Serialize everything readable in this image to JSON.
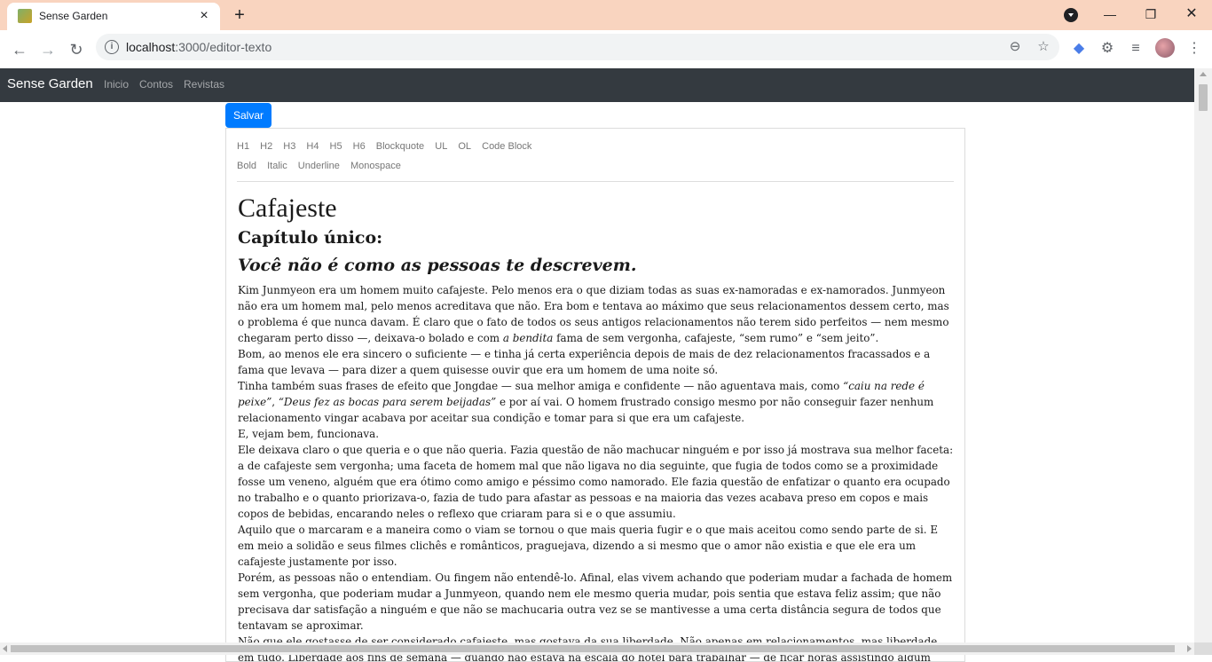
{
  "browser": {
    "tab_title": "Sense Garden",
    "url_host": "localhost",
    "url_path": ":3000/editor-texto",
    "info_icon": "info-icon",
    "tab_close": "×",
    "new_tab": "+"
  },
  "navbar": {
    "brand": "Sense Garden",
    "links": [
      "Inicio",
      "Contos",
      "Revistas"
    ]
  },
  "editor": {
    "save_label": "Salvar",
    "block_buttons": [
      "H1",
      "H2",
      "H3",
      "H4",
      "H5",
      "H6",
      "Blockquote",
      "UL",
      "OL",
      "Code Block"
    ],
    "inline_buttons": [
      "Bold",
      "Italic",
      "Underline",
      "Monospace"
    ]
  },
  "document": {
    "title": "Cafajeste",
    "subtitle": "Capítulo único:",
    "tagline": "Você não é como as pessoas te descrevem.",
    "paragraphs": [
      [
        "Kim Junmyeon era um homem muito cafajeste. Pelo menos era o que diziam todas as suas ex-namoradas e ex-namorados. Junmyeon não era um homem mal, pelo menos acreditava que não. Era bom e tentava ao máximo que seus relacionamentos dessem certo, mas o problema é que nunca davam. É claro que o fato de todos os seus antigos relacionamentos não terem sido perfeitos — nem mesmo chegaram perto disso —, deixava-o bolado e com ",
        {
          "i": "a bendita"
        },
        " fama de sem vergonha, cafajeste, “sem rumo” e “sem jeito”."
      ],
      [
        "Bom, ao menos ele era sincero o suficiente — e tinha já certa experiência depois de mais de dez relacionamentos fracassados e a fama que levava — para dizer a quem quisesse ouvir que era um homem de uma noite só."
      ],
      [
        "Tinha também suas frases de efeito que Jongdae — sua melhor amiga e confidente — não aguentava mais, como ",
        {
          "i": "“caiu na rede é peixe”"
        },
        ", ",
        {
          "i": "“Deus fez as bocas para serem beijadas”"
        },
        " e por aí vai. O homem frustrado consigo mesmo por não conseguir fazer nenhum relacionamento vingar acabava por aceitar sua condição e tomar para si que era um cafajeste."
      ],
      [
        "E, vejam bem, funcionava."
      ],
      [
        "Ele deixava claro o que queria e o que não queria. Fazia questão de não machucar ninguém e por isso já mostrava sua melhor faceta: a de cafajeste sem vergonha; uma faceta de homem mal que não ligava no dia seguinte, que fugia de todos como se a proximidade fosse um veneno, alguém que era ótimo como amigo e péssimo como namorado. Ele fazia questão de enfatizar o quanto era ocupado no trabalho e o quanto priorizava-o, fazia de tudo para afastar as pessoas e na maioria das vezes acabava preso em copos e mais copos de bebidas, encarando neles o reflexo que criaram para si e o que assumiu."
      ],
      [
        "Aquilo que o marcaram e a maneira como o viam se tornou o que mais queria fugir e o que mais aceitou como sendo parte de si. E em meio a solidão e seus filmes clichês e românticos, praguejava, dizendo a si mesmo que o amor não existia e que ele era um cafajeste justamente por isso."
      ],
      [
        "Porém, as pessoas não o entendiam. Ou fingem não entendê-lo. Afinal, elas vivem achando que poderiam mudar a fachada de homem sem vergonha, que poderiam mudar a Junmyeon, quando nem ele mesmo queria mudar, pois sentia que estava feliz assim; que não precisava dar satisfação a ninguém e que não se machucaria outra vez se se mantivesse a uma certa distância segura de todos que tentavam se aproximar."
      ],
      [
        "Não que ele gostasse de ser considerado cafajeste, mas gostava da sua liberdade. Não apenas em relacionamentos, mas liberdade em tudo. Liberdade aos fins de semana — quando não estava na escala do hotel para trabalhar — de ficar horas assistindo algum desenho infantil, ou algum anime fofo, ou a filmes românticos — que sabeia de cor e saltado a noite."
      ]
    ]
  }
}
